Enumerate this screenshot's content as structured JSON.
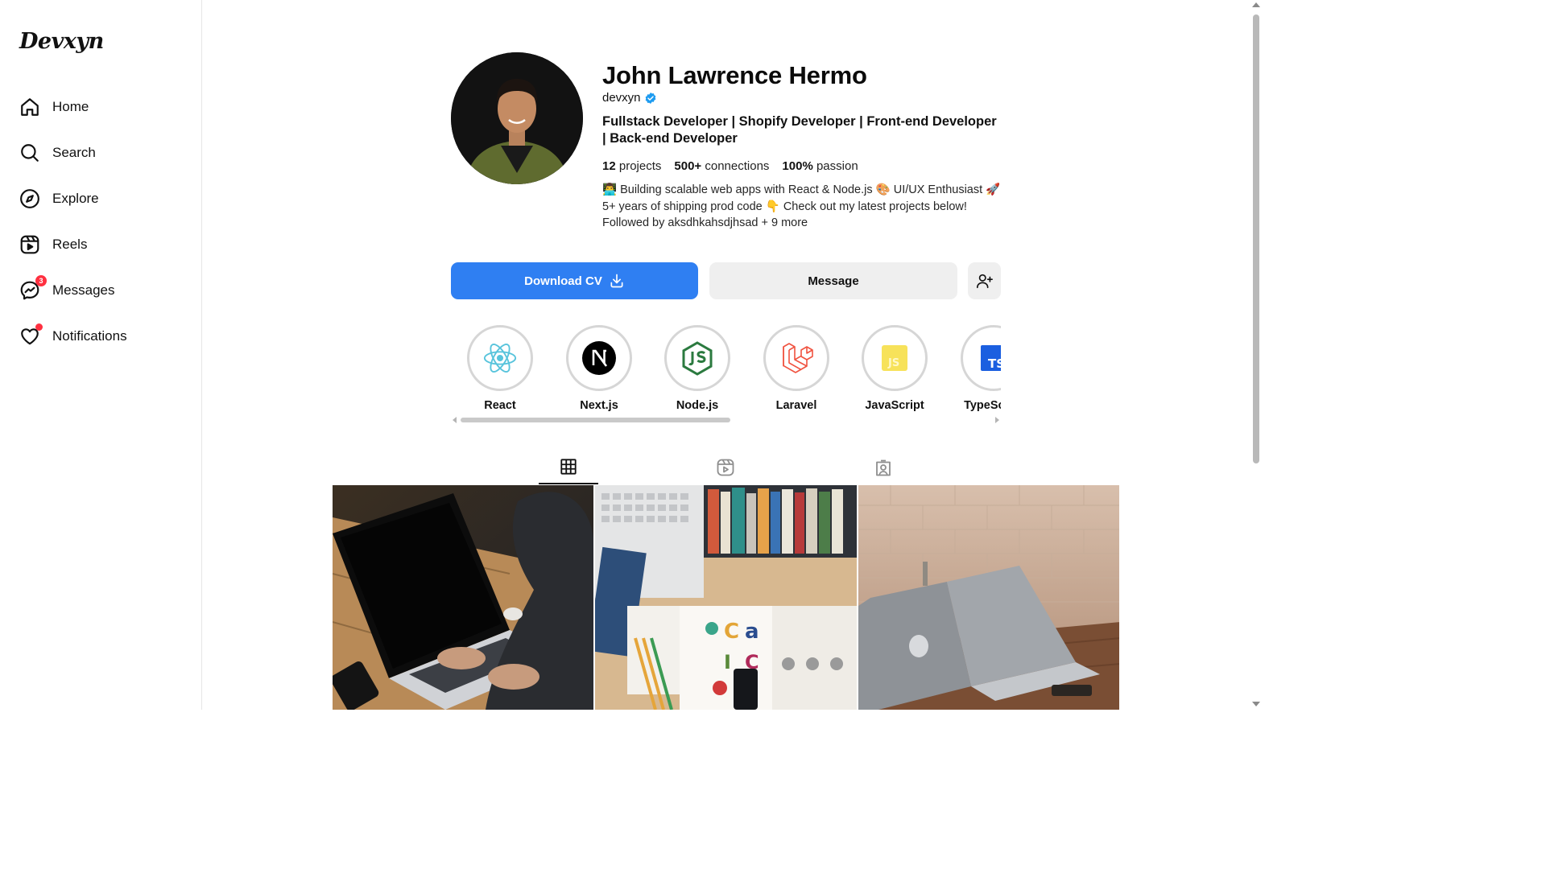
{
  "brand": {
    "logo_text": "Devxyn"
  },
  "sidebar": {
    "items": [
      {
        "label": "Home",
        "icon": "home-icon"
      },
      {
        "label": "Search",
        "icon": "search-icon"
      },
      {
        "label": "Explore",
        "icon": "compass-icon"
      },
      {
        "label": "Reels",
        "icon": "reels-icon"
      },
      {
        "label": "Messages",
        "icon": "messenger-icon",
        "badge": "3"
      },
      {
        "label": "Notifications",
        "icon": "heart-icon",
        "has_dot": true
      }
    ]
  },
  "profile": {
    "name": "John Lawrence Hermo",
    "username": "devxyn",
    "verified": true,
    "headline": "Fullstack Developer | Shopify Developer | Front-end Developer | Back-end Developer",
    "stats": [
      {
        "value": "12",
        "label": "projects"
      },
      {
        "value": "500+",
        "label": "connections"
      },
      {
        "value": "100%",
        "label": "passion"
      }
    ],
    "bio_lines": [
      "👨‍💻 Building scalable web apps with React & Node.js 🎨 UI/UX Enthusiast 🚀",
      "5+ years of shipping prod code 👇 Check out my latest projects below!",
      "Followed by aksdhkahsdjhsad + 9 more"
    ]
  },
  "actions": {
    "download_cv_label": "Download CV",
    "message_label": "Message",
    "add_user_icon": "add-user-icon"
  },
  "highlights": [
    {
      "label": "React",
      "icon": "react-icon"
    },
    {
      "label": "Next.js",
      "icon": "nextjs-icon"
    },
    {
      "label": "Node.js",
      "icon": "nodejs-icon"
    },
    {
      "label": "Laravel",
      "icon": "laravel-icon"
    },
    {
      "label": "JavaScript",
      "icon": "javascript-icon"
    },
    {
      "label": "TypeScript",
      "icon": "typescript-icon"
    }
  ],
  "tabs": [
    {
      "name": "posts",
      "icon": "grid-icon",
      "active": true
    },
    {
      "name": "reels",
      "icon": "reels-icon",
      "active": false
    },
    {
      "name": "tagged",
      "icon": "tagged-icon",
      "active": false
    }
  ],
  "posts": [
    {
      "subject": "person typing on laptop"
    },
    {
      "subject": "desk flatlay with laptop and books"
    },
    {
      "subject": "silver laptop on wooden table"
    }
  ],
  "colors": {
    "primary_button": "#2f7ff2",
    "secondary_button": "#efefef",
    "badge_red": "#ff3040",
    "verified_blue": "#1d9bf0"
  }
}
